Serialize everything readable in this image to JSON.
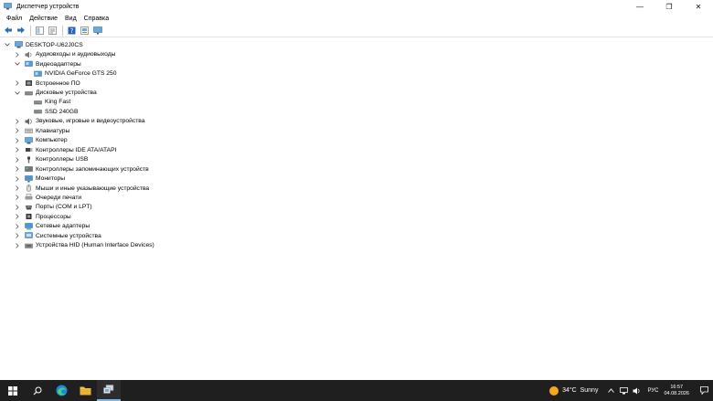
{
  "window": {
    "title": "Диспетчер устройств",
    "minimize_glyph": "—",
    "maximize_glyph": "❐",
    "close_glyph": "✕"
  },
  "menu": [
    "Файл",
    "Действие",
    "Вид",
    "Справка"
  ],
  "toolbar": {
    "buttons": [
      "back-arrow-icon",
      "forward-arrow-icon",
      "show-hide-tree-icon",
      "properties-icon",
      "help-icon",
      "update-driver-icon",
      "monitor-scan-icon"
    ]
  },
  "tree": {
    "root": "DESKTOP-U62J0CS",
    "items": [
      {
        "label": "Аудиовходы и аудиовыходы",
        "level": 1,
        "expanded": false,
        "icon": "audio-icon"
      },
      {
        "label": "Видеоадаптеры",
        "level": 1,
        "expanded": true,
        "icon": "display-adapter-icon"
      },
      {
        "label": "NVIDIA GeForce GTS 250",
        "level": 2,
        "expanded": null,
        "icon": "display-adapter-icon"
      },
      {
        "label": "Встроенное ПО",
        "level": 1,
        "expanded": false,
        "icon": "firmware-icon"
      },
      {
        "label": "Дисковые устройства",
        "level": 1,
        "expanded": true,
        "icon": "disk-drive-icon"
      },
      {
        "label": "King Fast",
        "level": 2,
        "expanded": null,
        "icon": "disk-drive-icon"
      },
      {
        "label": "SSD 240GB",
        "level": 2,
        "expanded": null,
        "icon": "disk-drive-icon"
      },
      {
        "label": "Звуковые, игровые и видеоустройства",
        "level": 1,
        "expanded": false,
        "icon": "sound-icon"
      },
      {
        "label": "Клавиатуры",
        "level": 1,
        "expanded": false,
        "icon": "keyboard-icon"
      },
      {
        "label": "Компьютер",
        "level": 1,
        "expanded": false,
        "icon": "computer-icon"
      },
      {
        "label": "Контроллеры IDE ATA/ATAPI",
        "level": 1,
        "expanded": false,
        "icon": "ide-controller-icon"
      },
      {
        "label": "Контроллеры USB",
        "level": 1,
        "expanded": false,
        "icon": "usb-icon"
      },
      {
        "label": "Контроллеры запоминающих устройств",
        "level": 1,
        "expanded": false,
        "icon": "storage-controller-icon"
      },
      {
        "label": "Мониторы",
        "level": 1,
        "expanded": false,
        "icon": "monitor-icon"
      },
      {
        "label": "Мыши и иные указывающие устройства",
        "level": 1,
        "expanded": false,
        "icon": "mouse-icon"
      },
      {
        "label": "Очереди печати",
        "level": 1,
        "expanded": false,
        "icon": "printer-icon"
      },
      {
        "label": "Порты (COM и LPT)",
        "level": 1,
        "expanded": false,
        "icon": "port-icon"
      },
      {
        "label": "Процессоры",
        "level": 1,
        "expanded": false,
        "icon": "processor-icon"
      },
      {
        "label": "Сетевые адаптеры",
        "level": 1,
        "expanded": false,
        "icon": "network-adapter-icon"
      },
      {
        "label": "Системные устройства",
        "level": 1,
        "expanded": false,
        "icon": "system-device-icon"
      },
      {
        "label": "Устройства HID (Human Interface Devices)",
        "level": 1,
        "expanded": false,
        "icon": "hid-icon"
      }
    ]
  },
  "taskbar": {
    "pinned": [
      "windows-start-icon",
      "search-icon",
      "edge-browser-icon",
      "file-explorer-icon",
      "device-manager-taskbar-icon"
    ],
    "weather": "34°C  Sunny",
    "language": "РУС",
    "time": "16:57",
    "date": "04.08.2026"
  },
  "colors": {
    "taskbar_bg": "#1f1f1f",
    "accent": "#7db7e8",
    "sun": "#f5a623"
  }
}
